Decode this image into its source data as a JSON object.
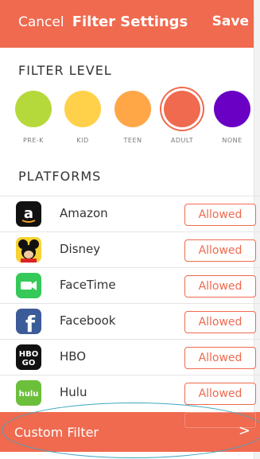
{
  "header": {
    "cancel_label": "Cancel",
    "title": "Filter Settings",
    "save_label": "Save"
  },
  "filter_level": {
    "title": "FILTER LEVEL",
    "levels": [
      {
        "label": "PRE-K",
        "color": "#b5d93a"
      },
      {
        "label": "KID",
        "color": "#ffd049"
      },
      {
        "label": "TEEN",
        "color": "#ffa647"
      },
      {
        "label": "ADULT",
        "color": "#ef6a4f",
        "selected": true
      },
      {
        "label": "NONE",
        "color": "#6a00c4"
      }
    ]
  },
  "platforms": {
    "title": "PLATFORMS",
    "items": [
      {
        "name": "Amazon",
        "status": "Allowed",
        "icon": "amazon-icon"
      },
      {
        "name": "Disney",
        "status": "Allowed",
        "icon": "disney-icon"
      },
      {
        "name": "FaceTime",
        "status": "Allowed",
        "icon": "facetime-icon"
      },
      {
        "name": "Facebook",
        "status": "Allowed",
        "icon": "facebook-icon"
      },
      {
        "name": "HBO",
        "status": "Allowed",
        "icon": "hbo-go-icon"
      },
      {
        "name": "Hulu",
        "status": "Allowed",
        "icon": "hulu-icon"
      }
    ]
  },
  "footer": {
    "custom_filter_label": "Custom Filter",
    "chevron": ">"
  },
  "colors": {
    "accent": "#ef6a4f",
    "highlight_oval": "#3ea6c2"
  }
}
